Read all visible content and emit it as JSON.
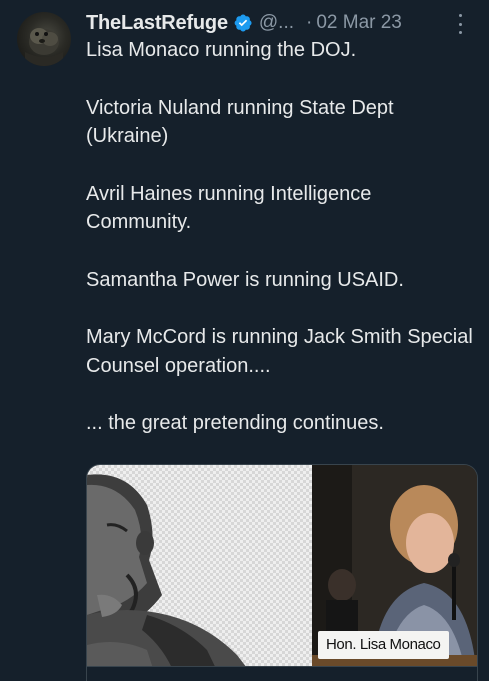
{
  "tweet": {
    "display_name": "TheLastRefuge",
    "handle": "@...",
    "separator": "·",
    "date": "02 Mar 23",
    "verified_icon": "verified-badge-icon",
    "more_icon": "more-vertical-icon",
    "paragraphs": [
      "Lisa Monaco running the DOJ.",
      "Victoria Nuland running State Dept (Ukraine)",
      "Avril Haines running Intelligence Community.",
      "Samantha Power is running USAID.",
      "Mary McCord is running Jack Smith Special Counsel operation....",
      "... the great pretending continues."
    ],
    "media": {
      "caption": "Hon. Lisa Monaco"
    }
  },
  "colors": {
    "background": "#15202b",
    "text_primary": "#e7e9ea",
    "text_secondary": "#8b98a5",
    "verified_blue": "#1d9bf0"
  }
}
